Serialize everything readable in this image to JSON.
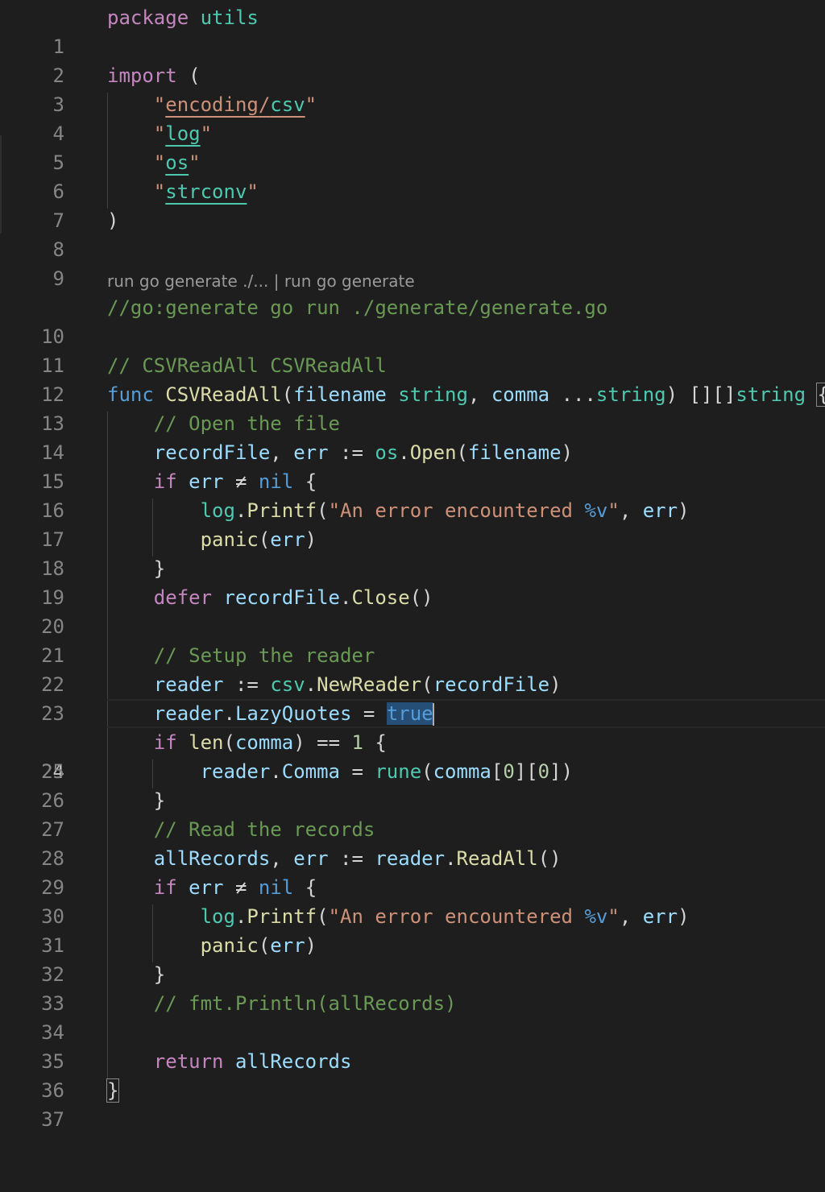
{
  "active_line": "24",
  "codelens": {
    "action1": "run go generate ./...",
    "separator": " | ",
    "action2": "run go generate"
  },
  "lines": [
    {
      "n": "1",
      "t": [
        "package",
        "utils"
      ]
    },
    {
      "n": "2"
    },
    {
      "n": "3",
      "t": [
        "import",
        "("
      ]
    },
    {
      "n": "4",
      "t": [
        "\"",
        "encoding",
        "/",
        "csv",
        "\""
      ]
    },
    {
      "n": "5",
      "t": [
        "\"",
        "log",
        "\""
      ]
    },
    {
      "n": "6",
      "t": [
        "\"",
        "os",
        "\""
      ]
    },
    {
      "n": "7",
      "t": [
        "\"",
        "strconv",
        "\""
      ]
    },
    {
      "n": "8",
      "t": [
        ")"
      ]
    },
    {
      "n": "9"
    },
    {
      "n": "10",
      "t": [
        "//go:generate go run ./generate/generate.go"
      ]
    },
    {
      "n": "11"
    },
    {
      "n": "12",
      "t": [
        "// CSVReadAll CSVReadAll"
      ]
    },
    {
      "n": "13",
      "t": [
        "func",
        "CSVReadAll",
        "(",
        "filename",
        "string",
        ",",
        "comma",
        "...",
        "string",
        ")",
        "[][]",
        "string",
        "{"
      ]
    },
    {
      "n": "14",
      "t": [
        "// Open the file"
      ]
    },
    {
      "n": "15",
      "t": [
        "recordFile",
        ",",
        "err",
        ":=",
        "os",
        ".",
        "Open",
        "(",
        "filename",
        ")"
      ]
    },
    {
      "n": "16",
      "t": [
        "if",
        "err",
        "≠",
        "nil",
        "{"
      ]
    },
    {
      "n": "17",
      "t": [
        "log",
        ".",
        "Printf",
        "(",
        "\"An error encountered ",
        "%v",
        "\"",
        ",",
        "err",
        ")"
      ]
    },
    {
      "n": "18",
      "t": [
        "panic",
        "(",
        "err",
        ")"
      ]
    },
    {
      "n": "19",
      "t": [
        "}"
      ]
    },
    {
      "n": "20",
      "t": [
        "defer",
        "recordFile",
        ".",
        "Close",
        "()"
      ]
    },
    {
      "n": "21"
    },
    {
      "n": "22",
      "t": [
        "// Setup the reader"
      ]
    },
    {
      "n": "23",
      "t": [
        "reader",
        ":=",
        "csv",
        ".",
        "NewReader",
        "(",
        "recordFile",
        ")"
      ]
    },
    {
      "n": "24",
      "t": [
        "reader",
        ".",
        "LazyQuotes",
        "=",
        "true"
      ]
    },
    {
      "n": "25",
      "t": [
        "if",
        "len",
        "(",
        "comma",
        ")",
        "==",
        "1",
        "{"
      ]
    },
    {
      "n": "26",
      "t": [
        "reader",
        ".",
        "Comma",
        "=",
        "rune",
        "(",
        "comma",
        "[",
        "0",
        "][",
        "0",
        "])"
      ]
    },
    {
      "n": "27",
      "t": [
        "}"
      ]
    },
    {
      "n": "28",
      "t": [
        "// Read the records"
      ]
    },
    {
      "n": "29",
      "t": [
        "allRecords",
        ",",
        "err",
        ":=",
        "reader",
        ".",
        "ReadAll",
        "()"
      ]
    },
    {
      "n": "30",
      "t": [
        "if",
        "err",
        "≠",
        "nil",
        "{"
      ]
    },
    {
      "n": "31",
      "t": [
        "log",
        ".",
        "Printf",
        "(",
        "\"An error encountered ",
        "%v",
        "\"",
        ",",
        "err",
        ")"
      ]
    },
    {
      "n": "32",
      "t": [
        "panic",
        "(",
        "err",
        ")"
      ]
    },
    {
      "n": "33",
      "t": [
        "}"
      ]
    },
    {
      "n": "34",
      "t": [
        "// fmt.Println(allRecords)"
      ]
    },
    {
      "n": "35"
    },
    {
      "n": "36",
      "t": [
        "return",
        "allRecords"
      ]
    },
    {
      "n": "37",
      "t": [
        "}"
      ]
    }
  ]
}
